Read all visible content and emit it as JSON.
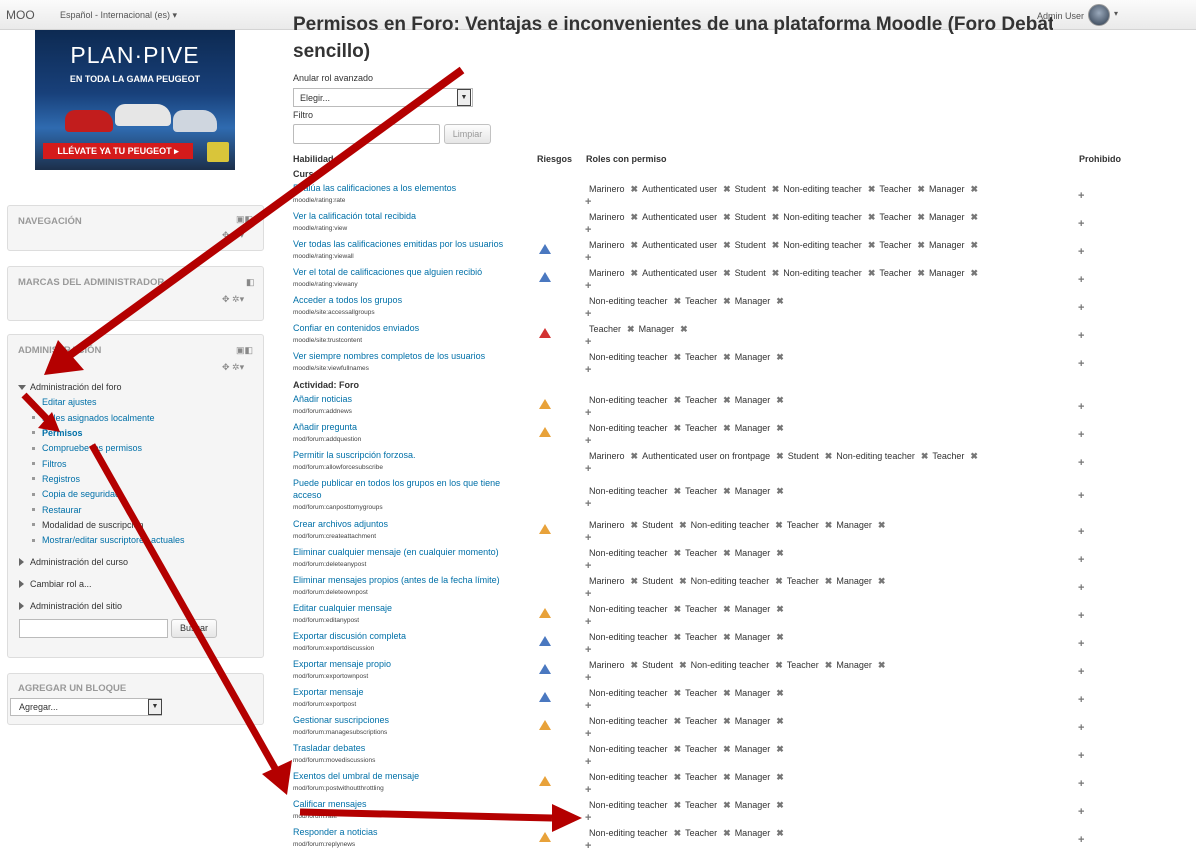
{
  "topbar": {
    "brand": "MOO",
    "language": "Español - Internacional (es) ▾",
    "user": "Admin User",
    "user_caret": "▾"
  },
  "ad": {
    "title": "PLAN·PIVE",
    "subtitle": "EN TODA LA GAMA PEUGEOT",
    "cta": "LLÉVATE YA TU PEUGEOT ▸"
  },
  "blocks": {
    "navigation": "NAVEGACIÓN",
    "admin_bookmarks": "MARCAS DEL ADMINISTRADOR",
    "administration": "ADMINISTRACIÓN",
    "add_block": "AGREGAR UN BLOQUE",
    "add_block_select": "Agregar...",
    "control_icons": "✥ ✲▾"
  },
  "admin_tree": {
    "forum_admin": "Administración del foro",
    "items": [
      "Editar ajustes",
      "Roles asignados localmente",
      "Permisos",
      "Compruebe los permisos",
      "Filtros",
      "Registros",
      "Copia de seguridad",
      "Restaurar",
      "Modalidad de suscripción",
      "Mostrar/editar suscriptores actuales"
    ],
    "course_admin": "Administración del curso",
    "switch_role": "Cambiar rol a...",
    "site_admin": "Administración del sitio",
    "search_button": "Buscar"
  },
  "main": {
    "title_line1": "Permisos en Foro: Ventajas e inconvenientes de una plataforma Moodle (Foro Debate",
    "title_line2": "sencillo)",
    "advanced_override_label": "Anular rol avanzado",
    "advanced_override_select": "Elegir...",
    "filter_label": "Filtro",
    "clear_button": "Limpiar",
    "headers": {
      "capability": "Habilidad",
      "risks": "Riesgos",
      "roles": "Roles con permiso",
      "prohibited": "Prohibido"
    },
    "section_course": "Curso",
    "section_forum": "Actividad: Foro",
    "plus": "+",
    "remove": "✖"
  },
  "capabilities": [
    {
      "name": "Evalúa las calificaciones a los elementos",
      "code": "moodle/rating:rate",
      "risk": "",
      "roles": [
        "Marinero",
        "Authenticated user",
        "Student",
        "Non-editing teacher",
        "Teacher",
        "Manager"
      ]
    },
    {
      "name": "Ver la calificación total recibida",
      "code": "moodle/rating:view",
      "risk": "",
      "roles": [
        "Marinero",
        "Authenticated user",
        "Student",
        "Non-editing teacher",
        "Teacher",
        "Manager"
      ]
    },
    {
      "name": "Ver todas las calificaciones emitidas por los usuarios",
      "code": "moodle/rating:viewall",
      "risk": "blue",
      "roles": [
        "Marinero",
        "Authenticated user",
        "Student",
        "Non-editing teacher",
        "Teacher",
        "Manager"
      ]
    },
    {
      "name": "Ver el total de calificaciones que alguien recibió",
      "code": "moodle/rating:viewany",
      "risk": "blue",
      "roles": [
        "Marinero",
        "Authenticated user",
        "Student",
        "Non-editing teacher",
        "Teacher",
        "Manager"
      ]
    },
    {
      "name": "Acceder a todos los grupos",
      "code": "moodle/site:accessallgroups",
      "risk": "",
      "roles": [
        "Non-editing teacher",
        "Teacher",
        "Manager"
      ]
    },
    {
      "name": "Confiar en contenidos enviados",
      "code": "moodle/site:trustcontent",
      "risk": "red",
      "roles": [
        "Teacher",
        "Manager"
      ]
    },
    {
      "name": "Ver siempre nombres completos de los usuarios",
      "code": "moodle/site:viewfullnames",
      "risk": "",
      "roles": [
        "Non-editing teacher",
        "Teacher",
        "Manager"
      ]
    },
    {
      "name": "Añadir noticias",
      "code": "mod/forum:addnews",
      "risk": "orange",
      "roles": [
        "Non-editing teacher",
        "Teacher",
        "Manager"
      ]
    },
    {
      "name": "Añadir pregunta",
      "code": "mod/forum:addquestion",
      "risk": "orange",
      "roles": [
        "Non-editing teacher",
        "Teacher",
        "Manager"
      ]
    },
    {
      "name": "Permitir la suscripción forzosa.",
      "code": "mod/forum:allowforcesubscribe",
      "risk": "",
      "roles": [
        "Marinero",
        "Authenticated user on frontpage",
        "Student",
        "Non-editing teacher",
        "Teacher"
      ]
    },
    {
      "name": "Puede publicar en todos los grupos en los que tiene",
      "name2": "acceso",
      "code": "mod/forum:canposttomygroups",
      "risk": "",
      "roles": [
        "Non-editing teacher",
        "Teacher",
        "Manager"
      ]
    },
    {
      "name": "Crear archivos adjuntos",
      "code": "mod/forum:createattachment",
      "risk": "orange",
      "roles": [
        "Marinero",
        "Student",
        "Non-editing teacher",
        "Teacher",
        "Manager"
      ]
    },
    {
      "name": "Eliminar cualquier mensaje (en cualquier momento)",
      "code": "mod/forum:deleteanypost",
      "risk": "",
      "roles": [
        "Non-editing teacher",
        "Teacher",
        "Manager"
      ]
    },
    {
      "name": "Eliminar mensajes propios (antes de la fecha límite)",
      "code": "mod/forum:deleteownpost",
      "risk": "",
      "roles": [
        "Marinero",
        "Student",
        "Non-editing teacher",
        "Teacher",
        "Manager"
      ]
    },
    {
      "name": "Editar cualquier mensaje",
      "code": "mod/forum:editanypost",
      "risk": "orange",
      "roles": [
        "Non-editing teacher",
        "Teacher",
        "Manager"
      ]
    },
    {
      "name": "Exportar discusión completa",
      "code": "mod/forum:exportdiscussion",
      "risk": "blue",
      "roles": [
        "Non-editing teacher",
        "Teacher",
        "Manager"
      ]
    },
    {
      "name": "Exportar mensaje propio",
      "code": "mod/forum:exportownpost",
      "risk": "blue",
      "roles": [
        "Marinero",
        "Student",
        "Non-editing teacher",
        "Teacher",
        "Manager"
      ]
    },
    {
      "name": "Exportar mensaje",
      "code": "mod/forum:exportpost",
      "risk": "blue",
      "roles": [
        "Non-editing teacher",
        "Teacher",
        "Manager"
      ]
    },
    {
      "name": "Gestionar suscripciones",
      "code": "mod/forum:managesubscriptions",
      "risk": "orange",
      "roles": [
        "Non-editing teacher",
        "Teacher",
        "Manager"
      ]
    },
    {
      "name": "Trasladar debates",
      "code": "mod/forum:movediscussions",
      "risk": "",
      "roles": [
        "Non-editing teacher",
        "Teacher",
        "Manager"
      ]
    },
    {
      "name": "Exentos del umbral de mensaje",
      "code": "mod/forum:postwithoutthrottling",
      "risk": "orange",
      "roles": [
        "Non-editing teacher",
        "Teacher",
        "Manager"
      ]
    },
    {
      "name": "Calificar mensajes",
      "code": "mod/forum:rate",
      "risk": "",
      "roles": [
        "Non-editing teacher",
        "Teacher",
        "Manager"
      ]
    },
    {
      "name": "Responder a noticias",
      "code": "mod/forum:replynews",
      "risk": "orange",
      "roles": [
        "Non-editing teacher",
        "Teacher",
        "Manager"
      ]
    }
  ],
  "colors": {
    "link": "#0070a8",
    "risk_blue": "#4a78c0",
    "risk_orange": "#e8a23a",
    "risk_red": "#d33333",
    "arrow": "#b40000"
  }
}
